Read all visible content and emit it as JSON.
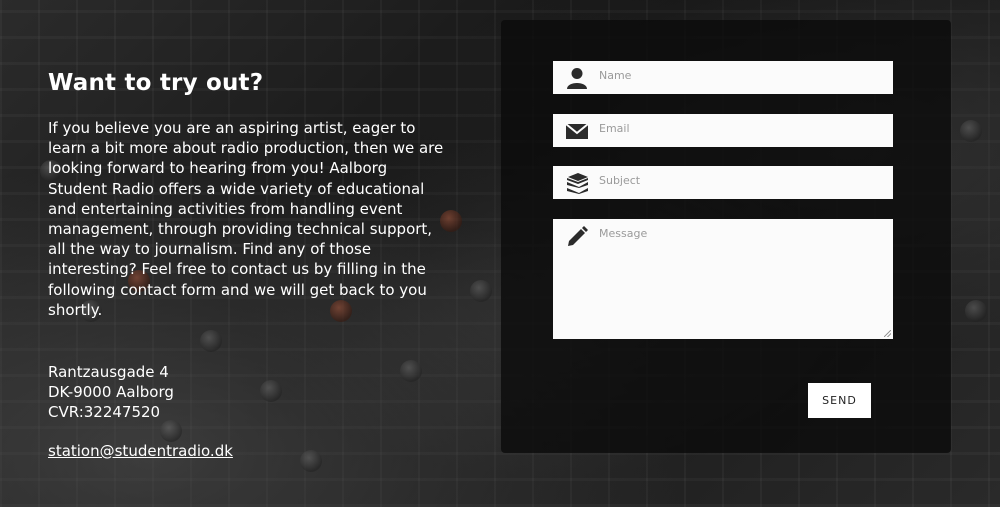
{
  "intro": {
    "title": "Want to try out?",
    "description": "If you believe you are an aspiring artist, eager to learn a bit more about radio production, then we are looking forward to hearing from you! Aalborg Student Radio offers a wide variety of educational and entertaining activities from handling event management, through providing technical support, all the way to journalism. Find any of those interesting? Feel free to contact us by filling in the following contact form and we will get back to you shortly."
  },
  "address": {
    "street": "Rantzausgade 4",
    "city": "DK-9000 Aalborg",
    "cvr": "CVR:32247520"
  },
  "contact_email": "station@studentradio.dk",
  "form": {
    "name_placeholder": "Name",
    "email_placeholder": "Email",
    "subject_placeholder": "Subject",
    "message_placeholder": "Message",
    "send_label": "SEND",
    "icons": [
      "user-icon",
      "envelope-icon",
      "books-icon",
      "pencil-icon"
    ]
  },
  "colors": {
    "panel": "#0a0a0a",
    "field": "#fbfbfb",
    "placeholder": "#9a9a9a"
  }
}
